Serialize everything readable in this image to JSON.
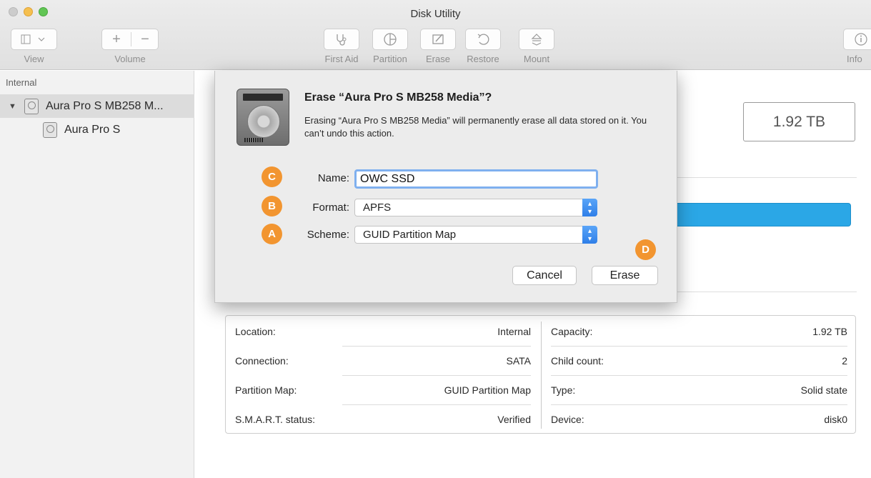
{
  "window": {
    "title": "Disk Utility"
  },
  "toolbar": {
    "view_label": "View",
    "volume_label": "Volume",
    "first_aid_label": "First Aid",
    "partition_label": "Partition",
    "erase_label": "Erase",
    "restore_label": "Restore",
    "mount_label": "Mount",
    "info_label": "Info"
  },
  "sidebar": {
    "section": "Internal",
    "items": [
      {
        "label": "Aura Pro S MB258 M..."
      },
      {
        "label": "Aura Pro S"
      }
    ]
  },
  "main": {
    "capacity_display": "1.92 TB"
  },
  "info": {
    "left": [
      {
        "label": "Location:",
        "value": "Internal"
      },
      {
        "label": "Connection:",
        "value": "SATA"
      },
      {
        "label": "Partition Map:",
        "value": "GUID Partition Map"
      },
      {
        "label": "S.M.A.R.T. status:",
        "value": "Verified"
      }
    ],
    "right": [
      {
        "label": "Capacity:",
        "value": "1.92 TB"
      },
      {
        "label": "Child count:",
        "value": "2"
      },
      {
        "label": "Type:",
        "value": "Solid state"
      },
      {
        "label": "Device:",
        "value": "disk0"
      }
    ]
  },
  "dialog": {
    "title": "Erase “Aura Pro S MB258 Media”?",
    "message": "Erasing “Aura Pro S MB258 Media” will permanently erase all data stored on it. You can’t undo this action.",
    "name_label": "Name:",
    "name_value": "OWC SSD",
    "format_label": "Format:",
    "format_value": "APFS",
    "scheme_label": "Scheme:",
    "scheme_value": "GUID Partition Map",
    "cancel_label": "Cancel",
    "erase_label": "Erase"
  },
  "badges": {
    "c": "C",
    "b": "B",
    "a": "A",
    "d": "D"
  },
  "colors": {
    "badge": "#f29530",
    "accent": "#2f7fe8",
    "bar": "#2ba7e6"
  }
}
